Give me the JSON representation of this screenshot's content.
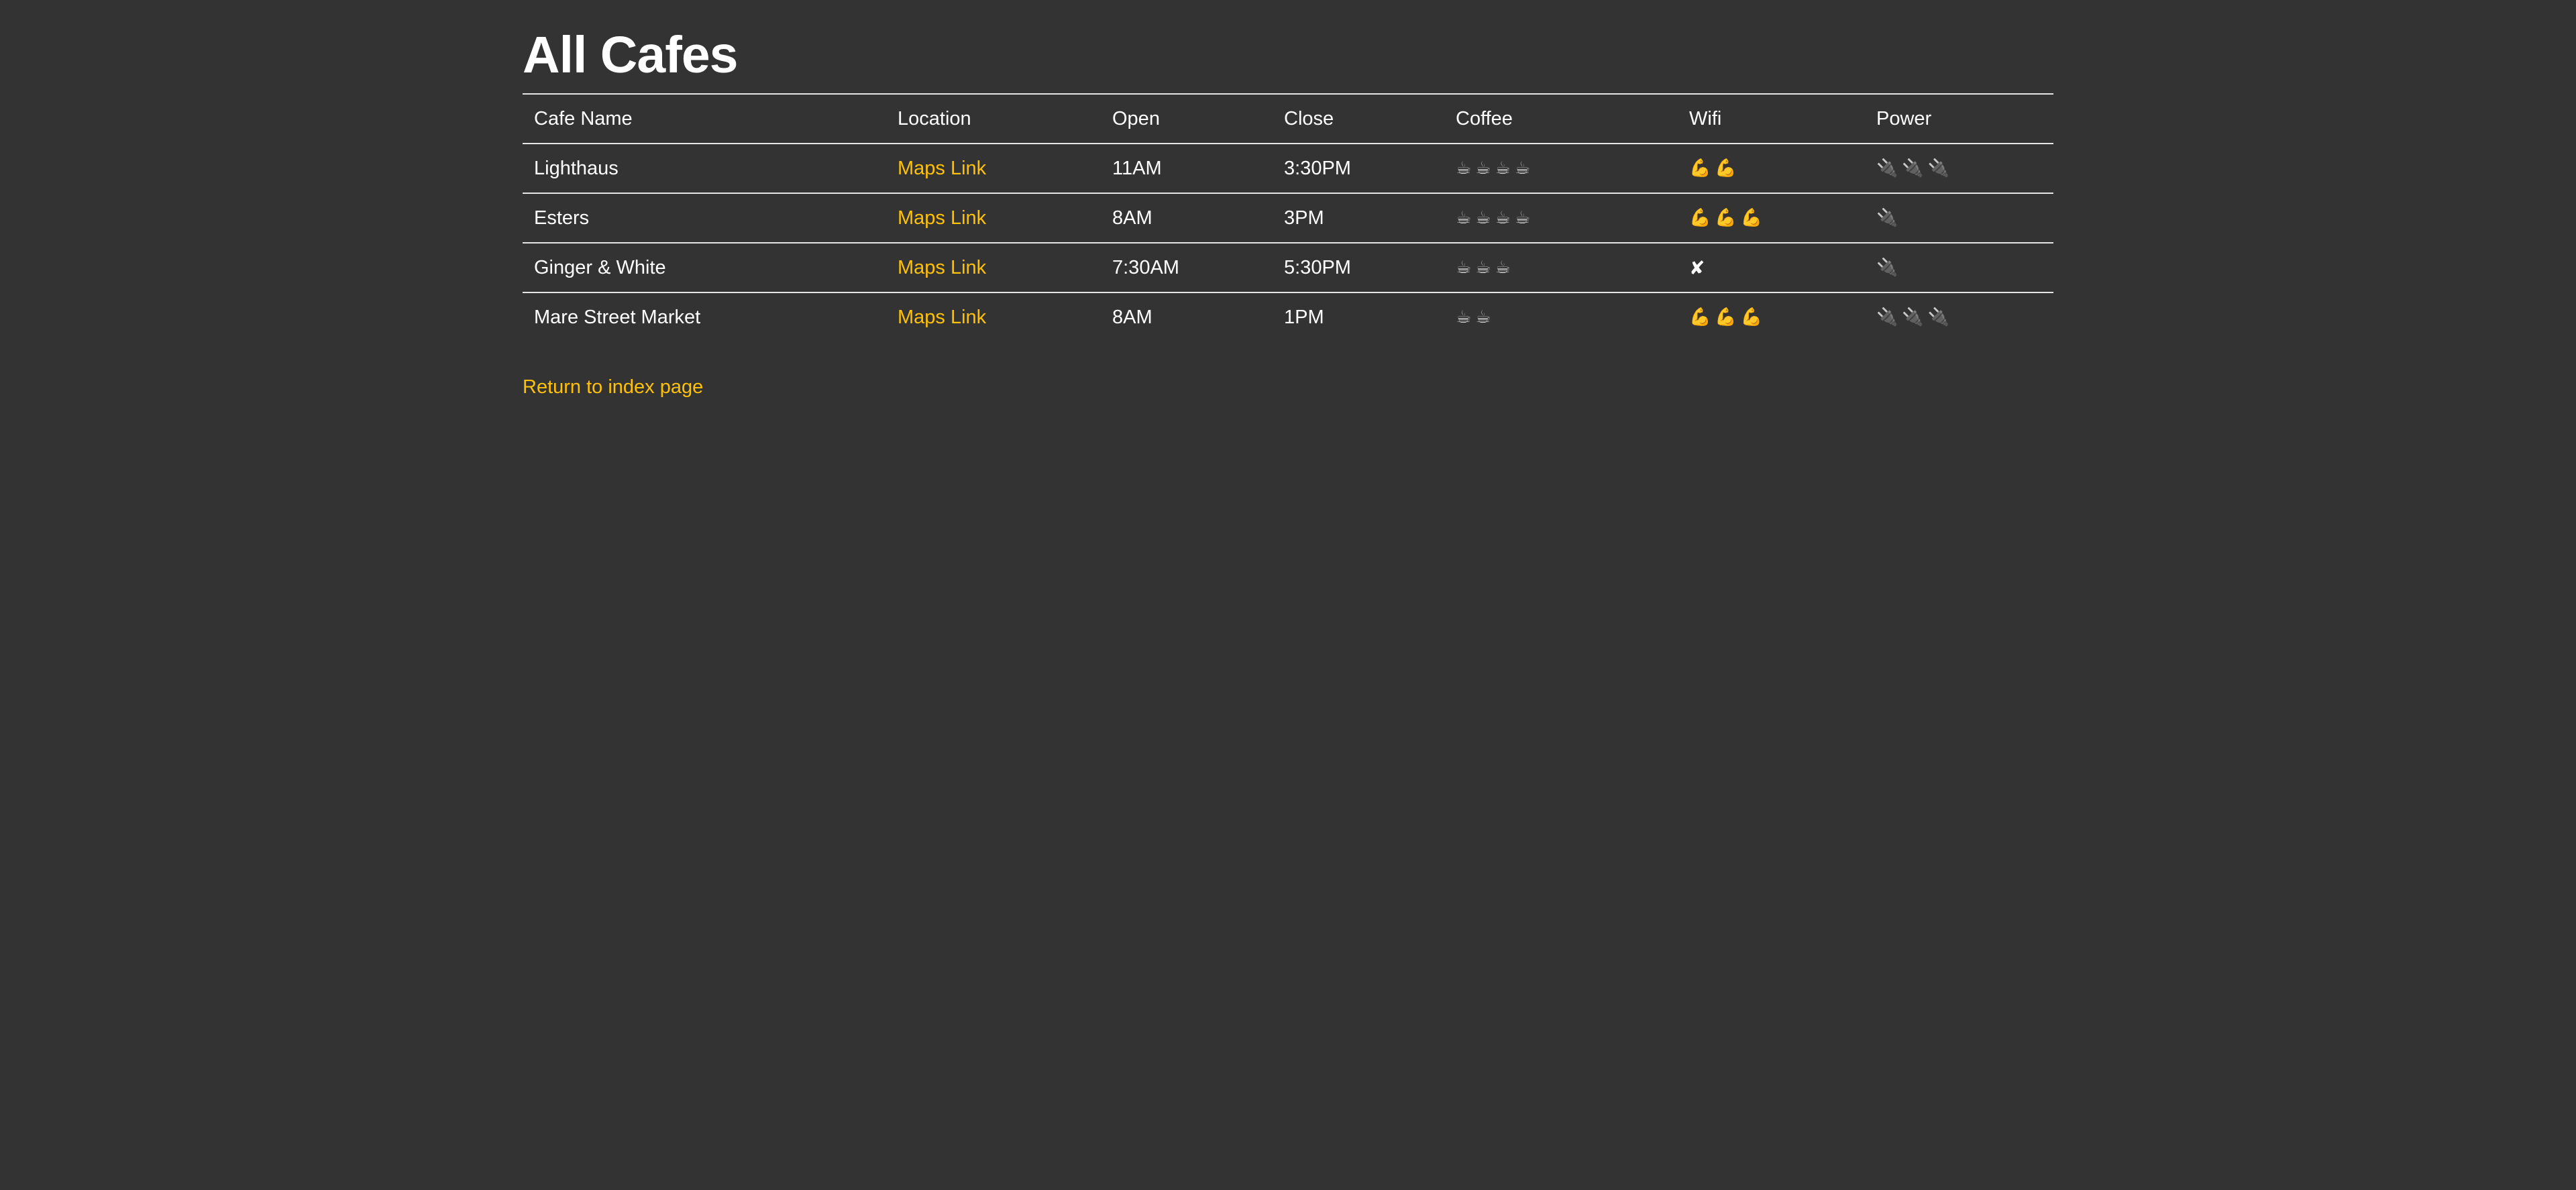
{
  "page": {
    "title": "All Cafes",
    "return_link": "Return to index page"
  },
  "colors": {
    "background": "#333333",
    "text": "#ffffff",
    "link": "#ffc107",
    "rule": "#e6e6e6"
  },
  "table": {
    "headers": {
      "name": "Cafe Name",
      "location": "Location",
      "open": "Open",
      "close": "Close",
      "coffee": "Coffee",
      "wifi": "Wifi",
      "power": "Power"
    },
    "rows": [
      {
        "name": "Lighthaus",
        "location": "Maps Link",
        "open": "11AM",
        "close": "3:30PM",
        "coffee": "☕☕☕☕",
        "wifi": "💪💪",
        "power": "🔌🔌🔌"
      },
      {
        "name": "Esters",
        "location": "Maps Link",
        "open": "8AM",
        "close": "3PM",
        "coffee": "☕☕☕☕",
        "wifi": "💪💪💪",
        "power": "🔌"
      },
      {
        "name": "Ginger & White",
        "location": "Maps Link",
        "open": "7:30AM",
        "close": "5:30PM",
        "coffee": "☕☕☕",
        "wifi": "✘",
        "power": "🔌"
      },
      {
        "name": "Mare Street Market",
        "location": "Maps Link",
        "open": "8AM",
        "close": "1PM",
        "coffee": "☕☕",
        "wifi": "💪💪💪",
        "power": "🔌🔌🔌"
      }
    ]
  }
}
